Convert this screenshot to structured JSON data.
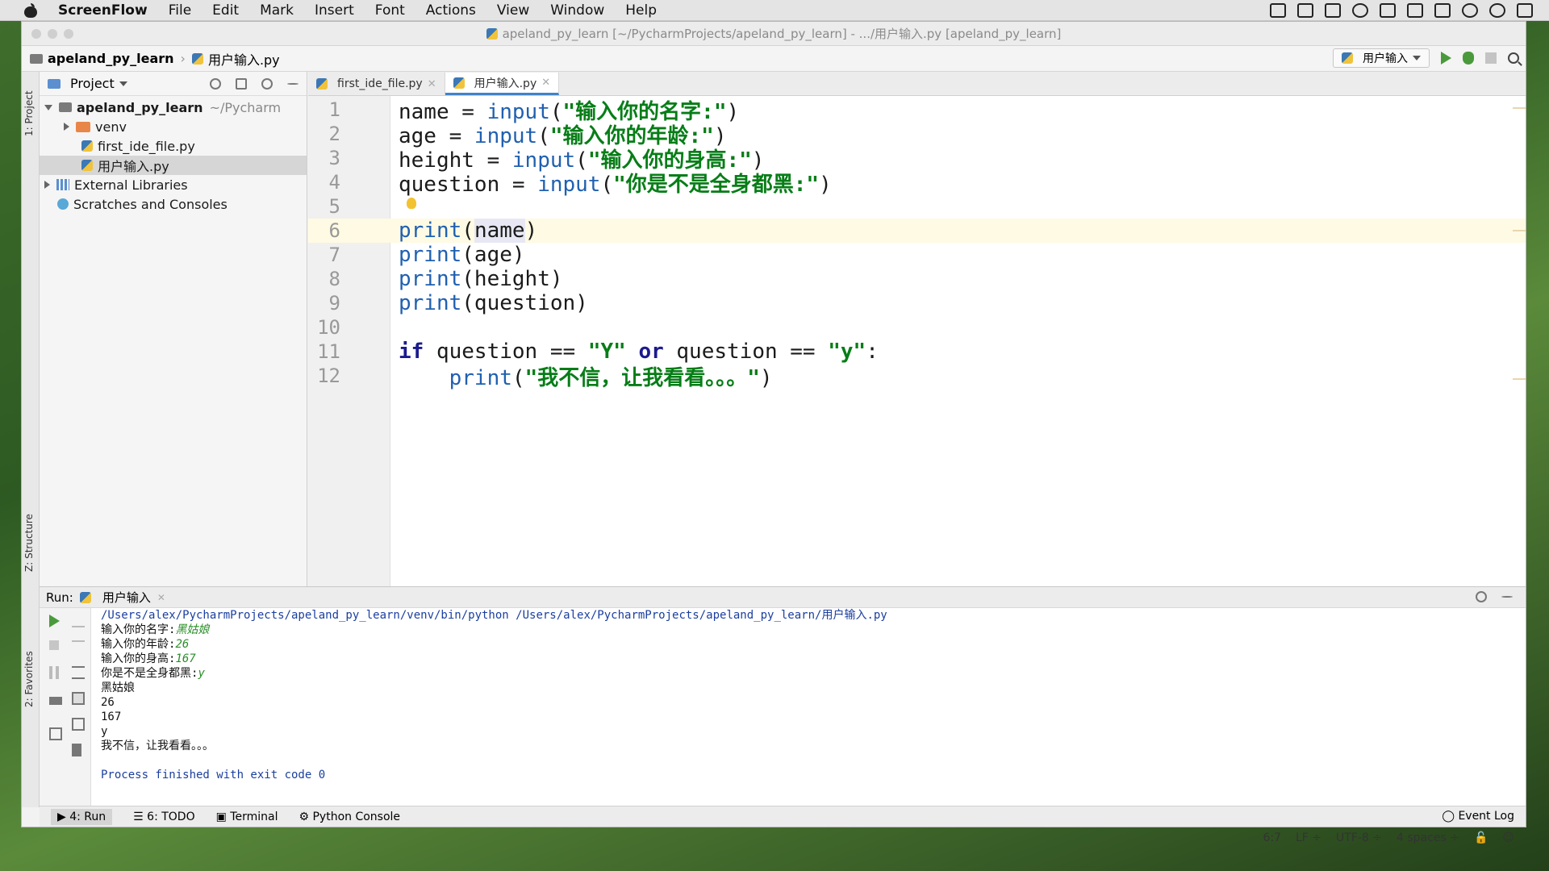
{
  "menubar": {
    "app": "ScreenFlow",
    "items": [
      "File",
      "Edit",
      "Mark",
      "Insert",
      "Font",
      "Actions",
      "View",
      "Window",
      "Help"
    ]
  },
  "window": {
    "title": "apeland_py_learn [~/PycharmProjects/apeland_py_learn] - .../用户输入.py [apeland_py_learn]"
  },
  "navbar": {
    "project": "apeland_py_learn",
    "file": "用户输入.py",
    "run_config": "用户输入"
  },
  "side_tabs": {
    "project": "1: Project",
    "structure": "Z: Structure",
    "favorites": "2: Favorites"
  },
  "project_panel": {
    "title": "Project",
    "root": "apeland_py_learn",
    "root_path": "~/Pycharm",
    "items": [
      "venv",
      "first_ide_file.py",
      "用户输入.py"
    ],
    "external": "External Libraries",
    "scratches": "Scratches and Consoles"
  },
  "editor": {
    "tabs": [
      "first_ide_file.py",
      "用户输入.py"
    ],
    "active_tab": 1,
    "current_line": 6,
    "line_numbers": [
      "1",
      "2",
      "3",
      "4",
      "5",
      "6",
      "7",
      "8",
      "9",
      "10",
      "11",
      "12"
    ]
  },
  "run": {
    "label": "Run:",
    "tab": "用户输入",
    "command": "/Users/alex/PycharmProjects/apeland_py_learn/venv/bin/python /Users/alex/PycharmProjects/apeland_py_learn/用户输入.py",
    "prompts": [
      {
        "prompt": "输入你的名字:",
        "value": "黑姑娘"
      },
      {
        "prompt": "输入你的年龄:",
        "value": "26"
      },
      {
        "prompt": "输入你的身高:",
        "value": "167"
      },
      {
        "prompt": "你是不是全身都黑:",
        "value": "y"
      }
    ],
    "outputs": [
      "黑姑娘",
      "26",
      "167",
      "y",
      "我不信，让我看看。。。"
    ],
    "exit": "Process finished with exit code 0"
  },
  "bottom_tools": {
    "run": "4: Run",
    "todo": "6: TODO",
    "terminal": "Terminal",
    "python_console": "Python Console",
    "event_log": "Event Log"
  },
  "status": {
    "position": "6:7",
    "line_sep": "LF",
    "encoding": "UTF-8",
    "indent": "4 spaces"
  }
}
